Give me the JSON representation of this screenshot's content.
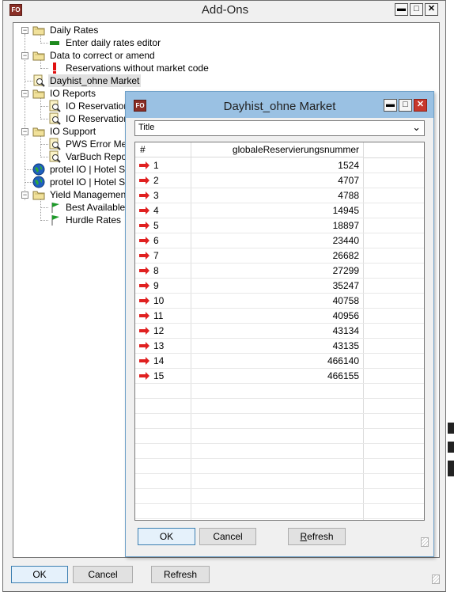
{
  "main_window": {
    "title": "Add-Ons",
    "controls": {
      "minimize": "▬",
      "maximize": "□",
      "close": "✕"
    },
    "app_icon_text": "FO"
  },
  "tree": {
    "items": [
      {
        "label": "Daily Rates",
        "type": "folder",
        "level": 0,
        "expanded": true
      },
      {
        "label": "Enter daily rates editor",
        "type": "green-arrow",
        "level": 1
      },
      {
        "label": "Data to correct or amend",
        "type": "folder",
        "level": 0,
        "expanded": true
      },
      {
        "label": "Reservations without market code",
        "type": "exclamation",
        "level": 1
      },
      {
        "label": "Dayhist_ohne Market",
        "type": "report",
        "level": 0,
        "selected": true
      },
      {
        "label": "IO Reports",
        "type": "folder",
        "level": 0,
        "expanded": true
      },
      {
        "label": "IO Reservation F",
        "type": "report",
        "level": 1
      },
      {
        "label": "IO Reservation P",
        "type": "report",
        "level": 1
      },
      {
        "label": "IO Support",
        "type": "folder",
        "level": 0,
        "expanded": true
      },
      {
        "label": "PWS Error Messa",
        "type": "report",
        "level": 1
      },
      {
        "label": "VarBuch Report",
        "type": "report",
        "level": 1
      },
      {
        "label": "protel IO | Hotel Statu",
        "type": "globe",
        "level": 0
      },
      {
        "label": "protel IO | Hotel Statu",
        "type": "globe",
        "level": 0
      },
      {
        "label": "Yield Management",
        "type": "folder",
        "level": 0,
        "expanded": true
      },
      {
        "label": "Best Available Ra",
        "type": "flag",
        "level": 1
      },
      {
        "label": "Hurdle Rates",
        "type": "flag",
        "level": 1
      }
    ]
  },
  "main_buttons": {
    "ok": "OK",
    "cancel": "Cancel",
    "refresh": "Refresh"
  },
  "dialog": {
    "title": "Dayhist_ohne Market",
    "app_icon_text": "FO",
    "controls": {
      "minimize": "▬",
      "maximize": "□",
      "close": "✕"
    },
    "combo_value": "Title",
    "combo_arrow": "⌄",
    "grid": {
      "columns": [
        "#",
        "globaleReservierungsnummer"
      ],
      "rows": [
        {
          "n": "1",
          "value": "1524"
        },
        {
          "n": "2",
          "value": "4707"
        },
        {
          "n": "3",
          "value": "4788"
        },
        {
          "n": "4",
          "value": "14945"
        },
        {
          "n": "5",
          "value": "18897"
        },
        {
          "n": "6",
          "value": "23440"
        },
        {
          "n": "7",
          "value": "26682"
        },
        {
          "n": "8",
          "value": "27299"
        },
        {
          "n": "9",
          "value": "35247"
        },
        {
          "n": "10",
          "value": "40758"
        },
        {
          "n": "11",
          "value": "40956"
        },
        {
          "n": "12",
          "value": "43134"
        },
        {
          "n": "13",
          "value": "43135"
        },
        {
          "n": "14",
          "value": "466140"
        },
        {
          "n": "15",
          "value": "466155"
        }
      ]
    },
    "buttons": {
      "ok": "OK",
      "cancel": "Cancel",
      "refresh": "Refresh",
      "refresh_mnemonic": "R"
    }
  },
  "colors": {
    "dialog_titlebar": "#9ac1e3",
    "close_button": "#c7382c",
    "row_arrow": "#e02020",
    "selection": "#e0e0e0"
  }
}
